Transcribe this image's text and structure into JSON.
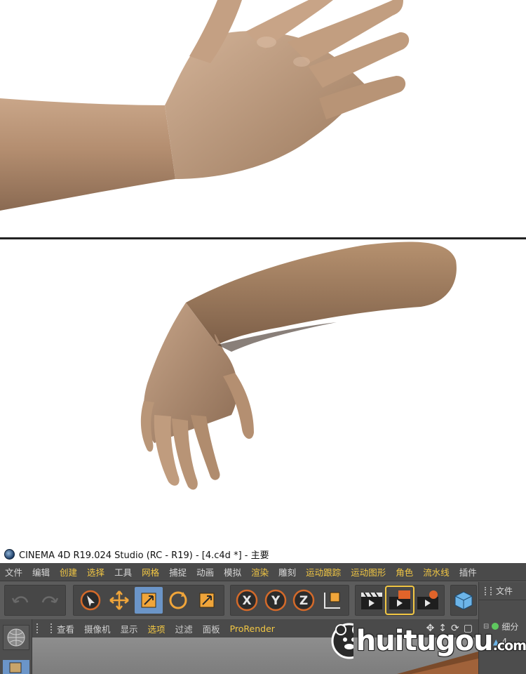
{
  "window": {
    "title": "CINEMA 4D R19.024 Studio (RC - R19) - [4.c4d *] - 主要"
  },
  "menubar": {
    "items": [
      {
        "label": "文件",
        "highlight": false
      },
      {
        "label": "编辑",
        "highlight": false
      },
      {
        "label": "创建",
        "highlight": true
      },
      {
        "label": "选择",
        "highlight": true
      },
      {
        "label": "工具",
        "highlight": false
      },
      {
        "label": "网格",
        "highlight": true
      },
      {
        "label": "捕捉",
        "highlight": false
      },
      {
        "label": "动画",
        "highlight": false
      },
      {
        "label": "模拟",
        "highlight": false
      },
      {
        "label": "渲染",
        "highlight": true
      },
      {
        "label": "雕刻",
        "highlight": false
      },
      {
        "label": "运动跟踪",
        "highlight": true
      },
      {
        "label": "运动图形",
        "highlight": true
      },
      {
        "label": "角色",
        "highlight": true
      },
      {
        "label": "流水线",
        "highlight": true
      },
      {
        "label": "插件",
        "highlight": false
      }
    ]
  },
  "toolbar": {
    "tools": [
      "undo-icon",
      "redo-icon",
      "live-selection-icon",
      "move-icon",
      "scale-icon",
      "rotate-icon",
      "last-tool-icon",
      "x-axis-icon",
      "y-axis-icon",
      "z-axis-icon",
      "coordinate-system-icon",
      "render-view-icon",
      "render-picture-viewer-icon",
      "render-settings-icon",
      "cube-icon"
    ],
    "active_tool": "scale"
  },
  "viewport_menu": {
    "items": [
      {
        "label": "查看",
        "highlight": false
      },
      {
        "label": "摄像机",
        "highlight": false
      },
      {
        "label": "显示",
        "highlight": false
      },
      {
        "label": "选项",
        "highlight": true
      },
      {
        "label": "过滤",
        "highlight": false
      },
      {
        "label": "面板",
        "highlight": false
      },
      {
        "label": "ProRender",
        "highlight": true
      }
    ]
  },
  "object_manager": {
    "file_label": "文件",
    "object_label": "细分",
    "child_label": "4"
  },
  "watermark": {
    "text": "huitugou",
    "suffix": ".com"
  },
  "colors": {
    "accent_yellow": "#f2c744",
    "active_blue": "#6b95c8",
    "ui_gray": "#5c5c5c",
    "skin": "#b08a6a"
  }
}
